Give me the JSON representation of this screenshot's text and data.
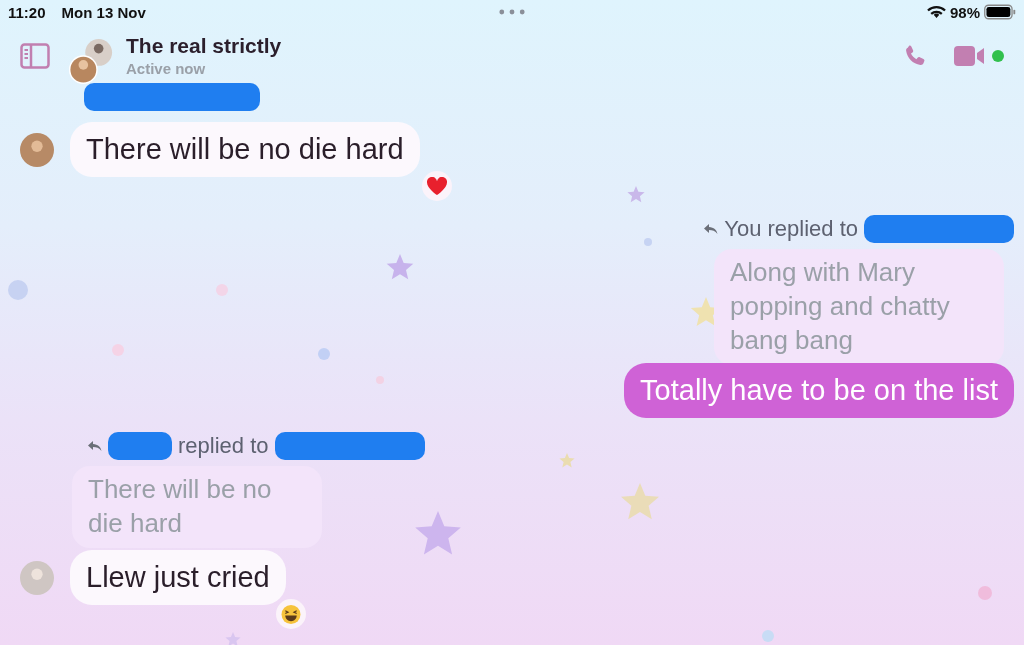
{
  "status_bar": {
    "time": "11:20",
    "date": "Mon 13 Nov",
    "battery": "98%"
  },
  "header": {
    "title": "The real strictly",
    "subtitle": "Active now",
    "online": true
  },
  "messages": [
    {
      "kind": "incoming",
      "sender_redacted": true,
      "text": "There will be no die hard",
      "reaction": {
        "kind": "heart"
      }
    },
    {
      "kind": "outgoing",
      "reply": {
        "label": "You replied to",
        "redacted_sender": true,
        "quote": "Along with Mary popping and chatty bang bang"
      },
      "text": "Totally have to be on the list"
    },
    {
      "kind": "incoming",
      "reply": {
        "label": "replied to",
        "redacted_sender": true,
        "quote": "There will be no die hard"
      },
      "text": "Llew just cried",
      "reaction": {
        "kind": "laugh"
      }
    }
  ]
}
